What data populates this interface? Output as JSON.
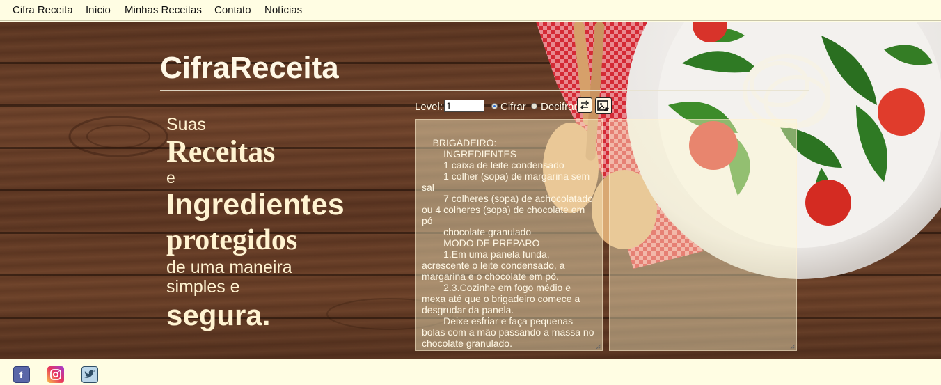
{
  "nav": {
    "brand": "Cifra Receita",
    "items": [
      "Início",
      "Minhas Receitas",
      "Contato",
      "Notícias"
    ]
  },
  "hero": {
    "title": "CifraReceita",
    "slogan": {
      "line1": "Suas",
      "line2": "Receitas",
      "line3": "e",
      "line4": "Ingredientes",
      "line5": "protegidos",
      "line6": "de uma maneira",
      "line7": "simples e",
      "line8": "segura."
    }
  },
  "controls": {
    "level_label": "Level:",
    "level_value": "1",
    "mode_cifrar": "Cifrar",
    "mode_decifrar": "Decifrar",
    "selected_mode": "Cifrar",
    "swap_icon": "swap-icon",
    "clear_icon": "image-edit-icon"
  },
  "input_text": "BRIGADEIRO:\n        INGREDIENTES\n        1 caixa de leite condensado\n        1 colher (sopa) de margarina sem sal\n        7 colheres (sopa) de achocolatado ou 4 colheres (sopa) de chocolate em pó\n        chocolate granulado\n        MODO DE PREPARO\n        1.Em uma panela funda, acrescente o leite condensado, a margarina e o chocolate em pó.\n        2.3.Cozinhe em fogo médio e mexa até que o brigadeiro comece a desgrudar da panela.\n        Deixe esfriar e faça pequenas bolas com a mão passando a massa no chocolate granulado.",
  "output_text": "",
  "footer": {
    "social": [
      "facebook-icon",
      "instagram-icon",
      "twitter-icon"
    ]
  },
  "colors": {
    "page_bg": "#fffde3",
    "wood": "#5e3722",
    "text_light": "#fff8e6",
    "facebook": "#3b4f8f",
    "instagram": "#d6267a",
    "twitter": "#5ea9dd"
  }
}
